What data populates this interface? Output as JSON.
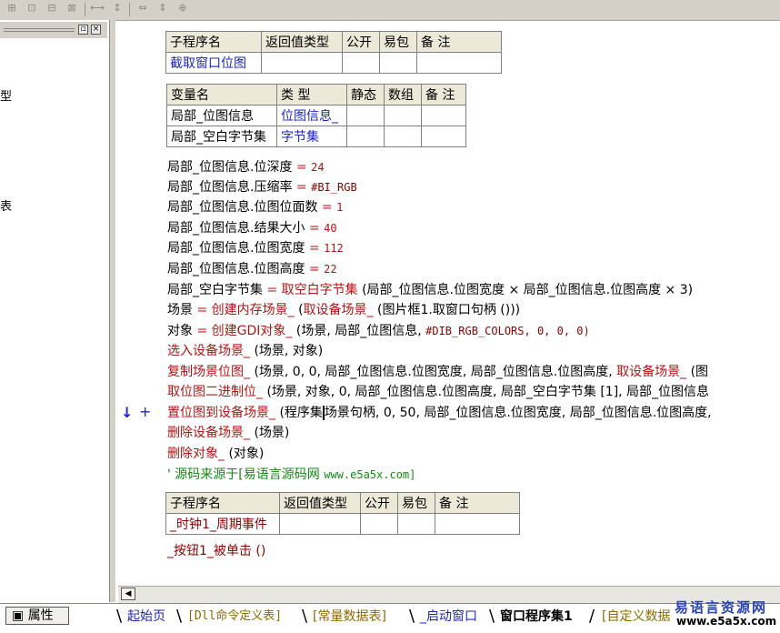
{
  "toolbar": {
    "icons": [
      "grid-icon",
      "grid-icon",
      "grid-icon",
      "grid-icon",
      "horizontal-space-icon",
      "vertical-space-icon",
      "width-icon",
      "height-icon",
      "center-icon"
    ]
  },
  "left_pane": {
    "fragments": [
      "型",
      "表"
    ],
    "props_button_label": "属性"
  },
  "subroutine_table": {
    "headers": [
      "子程序名",
      "返回值类型",
      "公开",
      "易包",
      "备 注"
    ],
    "row": [
      "截取窗口位图",
      "",
      "",
      "",
      ""
    ]
  },
  "var_table": {
    "headers": [
      "变量名",
      "类 型",
      "静态",
      "数组",
      "备 注"
    ],
    "rows": [
      [
        "局部_位图信息",
        "位图信息_",
        "",
        "",
        ""
      ],
      [
        "局部_空白字节集",
        "字节集",
        "",
        "",
        ""
      ]
    ]
  },
  "code_lines": [
    {
      "a": "局部_位图信息.位深度 ",
      "op": "= ",
      "b": "24"
    },
    {
      "a": "局部_位图信息.压缩率 ",
      "op": "= ",
      "b": "#BI_RGB"
    },
    {
      "a": "局部_位图信息.位图位面数 ",
      "op": "= ",
      "b": "1"
    },
    {
      "a": "局部_位图信息.结果大小 ",
      "op": "= ",
      "b": "40"
    },
    {
      "a": "局部_位图信息.位图宽度 ",
      "op": "= ",
      "b": "112"
    },
    {
      "a": "局部_位图信息.位图高度 ",
      "op": "= ",
      "b": "22"
    }
  ],
  "code_line7": {
    "a": "局部_空白字节集 ",
    "op": "= ",
    "fn": "取空白字节集",
    "b": " (局部_位图信息.位图宽度 × 局部_位图信息.位图高度 × 3)"
  },
  "code_line8": {
    "a": "场景 ",
    "op": "= ",
    "fn": "创建内存场景_",
    "b": " (",
    "fn2": "取设备场景_",
    "c": " (图片框1.取窗口句柄 ()))"
  },
  "code_line9": {
    "a": "对象 ",
    "op": "= ",
    "fn": "创建GDI对象_",
    "b": " (场景, 局部_位图信息, ",
    "c": "#DIB_RGB_COLORS, 0, 0, 0)"
  },
  "code_line10": {
    "fn": "选入设备场景_",
    "b": " (场景, 对象)"
  },
  "code_line11": {
    "fn": "复制场景位图_",
    "b": " (场景, 0, 0, 局部_位图信息.位图宽度, 局部_位图信息.位图高度, ",
    "fn2": "取设备场景_",
    "c": " (图"
  },
  "code_line12": {
    "fn": "取位图二进制位_",
    "b": " (场景, 对象, 0, 局部_位图信息.位图高度, 局部_空白字节集 [1], 局部_位图信息"
  },
  "code_line13": {
    "fn": "置位图到设备场景_",
    "b": " (程序集",
    "c": "场景句柄, 0, 50, 局部_位图信息.位图宽度, 局部_位图信息.位图高度,"
  },
  "code_line14": {
    "fn": "删除设备场景_",
    "b": " (场景)"
  },
  "code_line15": {
    "fn": "删除对象_",
    "b": " (对象)"
  },
  "comment_line": {
    "a": "' 源码来源于[易语言源码网 ",
    "b": "www.e5a5x.com]"
  },
  "gutter_markers": {
    "arrow": "↓",
    "plus": "+"
  },
  "subroutine_table2": {
    "headers": [
      "子程序名",
      "返回值类型",
      "公开",
      "易包",
      "备 注"
    ],
    "row": [
      "_时钟1_周期事件",
      "",
      "",
      "",
      ""
    ]
  },
  "last_line": "_按钮1_被单击 ()",
  "tabs": [
    "起始页",
    "[Dll命令定义表]",
    "[常量数据表]",
    "_启动窗口",
    "窗口程序集1",
    "[自定义数据"
  ],
  "watermark": {
    "title": "易语言资源网",
    "url": "www.e5a5x.com"
  },
  "colors": {
    "keyword": "#b01414",
    "type": "#1d26b8",
    "comment": "#138a13"
  }
}
